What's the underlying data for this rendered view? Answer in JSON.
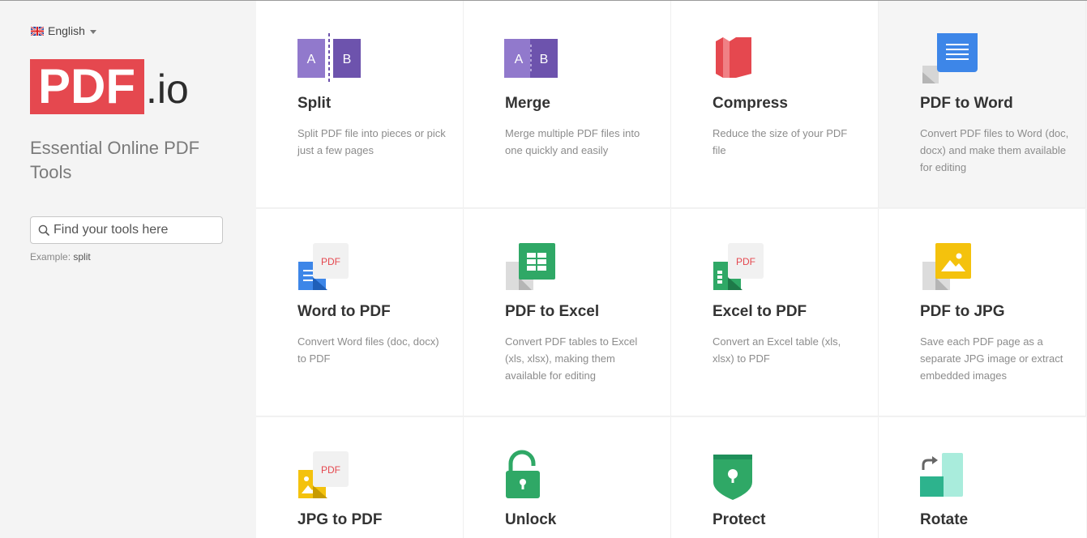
{
  "language": {
    "label": "English"
  },
  "logo": {
    "brand": "PDF",
    "suffix": ".io"
  },
  "tagline": "Essential Online PDF Tools",
  "search": {
    "placeholder": "Find your tools here",
    "value": ""
  },
  "example": {
    "prefix": "Example:",
    "value": "split"
  },
  "colors": {
    "brand_red": "#e5484f",
    "purple": "#7b5fb5",
    "word_blue": "#3d86e8",
    "excel_green": "#2fa866",
    "jpg_yellow": "#f4c20d",
    "teal": "#2db38d"
  },
  "tools": [
    {
      "title": "Split",
      "desc": "Split PDF file into pieces or pick just a few pages",
      "icon": "split-icon",
      "letters": [
        "A",
        "B"
      ]
    },
    {
      "title": "Merge",
      "desc": "Merge multiple PDF files into one quickly and easily",
      "icon": "merge-icon",
      "letters": [
        "A",
        "B"
      ]
    },
    {
      "title": "Compress",
      "desc": "Reduce the size of your PDF file",
      "icon": "compress-icon"
    },
    {
      "title": "PDF to Word",
      "desc": "Convert PDF files to Word (doc, docx) and make them available for editing",
      "icon": "pdf-to-word-icon"
    },
    {
      "title": "Word to PDF",
      "desc": "Convert Word files (doc, docx) to PDF",
      "icon": "word-to-pdf-icon",
      "badge": "PDF"
    },
    {
      "title": "PDF to Excel",
      "desc": "Convert PDF tables to Excel (xls, xlsx), making them available for editing",
      "icon": "pdf-to-excel-icon"
    },
    {
      "title": "Excel to PDF",
      "desc": "Convert an Excel table (xls, xlsx) to PDF",
      "icon": "excel-to-pdf-icon",
      "badge": "PDF"
    },
    {
      "title": "PDF to JPG",
      "desc": "Save each PDF page as a separate JPG image or extract embedded images",
      "icon": "pdf-to-jpg-icon"
    },
    {
      "title": "JPG to PDF",
      "desc": "",
      "icon": "jpg-to-pdf-icon",
      "badge": "PDF"
    },
    {
      "title": "Unlock",
      "desc": "",
      "icon": "unlock-icon"
    },
    {
      "title": "Protect",
      "desc": "",
      "icon": "protect-icon"
    },
    {
      "title": "Rotate",
      "desc": "",
      "icon": "rotate-icon"
    }
  ]
}
